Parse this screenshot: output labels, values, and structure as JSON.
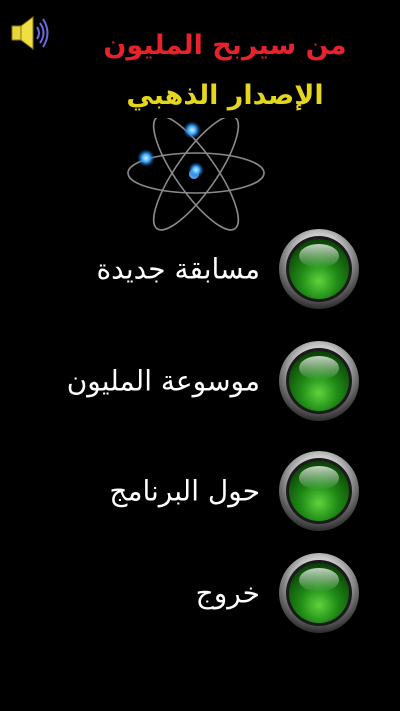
{
  "header": {
    "title_line1": "من سيربح المليون",
    "title_line2": "الإصدار الذهبي",
    "title_line1_color": "#e8222a",
    "title_line2_color": "#e6d61c"
  },
  "sound_button": {
    "icon": "speaker-icon"
  },
  "logo": {
    "icon": "atom-icon"
  },
  "menu": {
    "items": [
      {
        "label": "مسابقة جديدة",
        "icon": "green-round-button"
      },
      {
        "label": "موسوعة المليون",
        "icon": "green-round-button"
      },
      {
        "label": "حول البرنامج",
        "icon": "green-round-button"
      },
      {
        "label": "خروج",
        "icon": "green-round-button"
      }
    ],
    "button_color": "#1f8a16"
  }
}
